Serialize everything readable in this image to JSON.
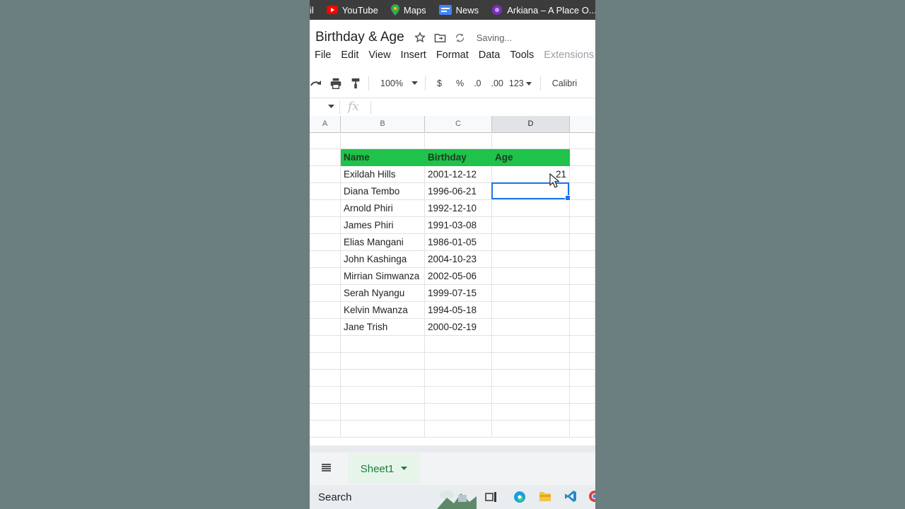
{
  "bookmarks": [
    {
      "label": "YouTube",
      "icon": "youtube-icon"
    },
    {
      "label": "Maps",
      "icon": "maps-icon"
    },
    {
      "label": "News",
      "icon": "news-icon"
    },
    {
      "label": "Arkiana – A Place O...",
      "icon": "arkiana-icon"
    }
  ],
  "bookmark_cut": "il",
  "doc": {
    "title": "Birthday & Age",
    "status": "Saving..."
  },
  "menu": [
    "File",
    "Edit",
    "View",
    "Insert",
    "Format",
    "Data",
    "Tools",
    "Extensions"
  ],
  "toolbar": {
    "zoom": "100%",
    "currency": "$",
    "percent": "%",
    "dec_down": ".0",
    "dec_up": ".00",
    "more_formats": "123",
    "font": "Calibri"
  },
  "formula": {
    "fx": "fx",
    "value": ""
  },
  "columns": [
    "A",
    "B",
    "C",
    "D"
  ],
  "table": {
    "headers": [
      "Name",
      "Birthday",
      "Age"
    ],
    "rows": [
      [
        "Exildah Hills",
        "2001-12-12",
        "21"
      ],
      [
        "Diana Tembo",
        "1996-06-21",
        ""
      ],
      [
        "Arnold Phiri",
        "1992-12-10",
        ""
      ],
      [
        "James Phiri",
        "1991-03-08",
        ""
      ],
      [
        "Elias Mangani",
        "1986-01-05",
        ""
      ],
      [
        "John Kashinga",
        "2004-10-23",
        ""
      ],
      [
        "Mirrian Simwanza",
        "2002-05-06",
        ""
      ],
      [
        "Serah Nyangu",
        "1999-07-15",
        ""
      ],
      [
        "Kelvin Mwanza",
        "1994-05-18",
        ""
      ],
      [
        "Jane Trish",
        "2000-02-19",
        ""
      ]
    ]
  },
  "sheet_tab": "Sheet1",
  "taskbar": {
    "search": "Search"
  },
  "colors": {
    "header_green": "#1fc24a",
    "selection_blue": "#1a73e8",
    "sheet_tab_green": "#188038"
  }
}
